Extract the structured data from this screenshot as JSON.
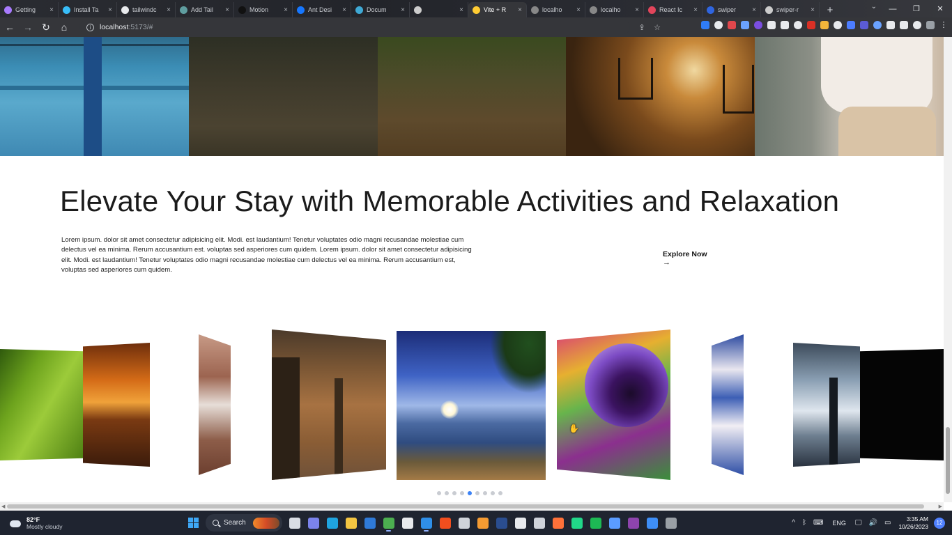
{
  "browser": {
    "tabs": [
      {
        "label": "Getting",
        "icon": "vite-icon",
        "color": "#a97bff"
      },
      {
        "label": "Install Ta",
        "icon": "tailwind-icon",
        "color": "#38bdf8"
      },
      {
        "label": "tailwindc",
        "icon": "google-icon",
        "color": "#e8eaed"
      },
      {
        "label": "Add Tail",
        "icon": "globe-icon",
        "color": "#5f9ea0"
      },
      {
        "label": "Motion",
        "icon": "framer-icon",
        "color": "#111111"
      },
      {
        "label": "Ant Desi",
        "icon": "antd-icon",
        "color": "#1677ff"
      },
      {
        "label": "Docum",
        "icon": "doc-icon",
        "color": "#3fa9d5"
      },
      {
        "label": "",
        "icon": "move-icon",
        "color": "#cccccc"
      },
      {
        "label": "Vite + R",
        "icon": "vite-icon",
        "color": "#ffcc33",
        "active": true
      },
      {
        "label": "localho",
        "icon": "globe-icon",
        "color": "#888888"
      },
      {
        "label": "localho",
        "icon": "globe-icon",
        "color": "#888888"
      },
      {
        "label": "React Ic",
        "icon": "react-icons-icon",
        "color": "#e2455b"
      },
      {
        "label": "swiper",
        "icon": "swiper-icon",
        "color": "#2f65e0"
      },
      {
        "label": "swiper-r",
        "icon": "code-icon",
        "color": "#cccccc"
      }
    ],
    "close_glyph": "×",
    "new_tab_glyph": "+",
    "tab_search_glyph": "⌄",
    "window_controls": {
      "minimize": "—",
      "restore": "❐",
      "close": "✕"
    },
    "nav": {
      "back": "←",
      "forward": "→",
      "reload": "↻",
      "home": "⌂"
    },
    "url_host": "localhost",
    "url_rest": ":5173/#",
    "addr_actions": {
      "share": "⇪",
      "bookmark": "☆"
    },
    "extensions": [
      {
        "name": "play-ext-icon",
        "color": "#2f7cf6"
      },
      {
        "name": "chat-ext-icon",
        "color": "#e8eaed"
      },
      {
        "name": "c-ext-icon",
        "color": "#e0474c"
      },
      {
        "name": "link-ext-icon",
        "color": "#6aa2ff"
      },
      {
        "name": "purple-ext-icon",
        "color": "#7a4ee0"
      },
      {
        "name": "box-ext-icon",
        "color": "#e8eaed"
      },
      {
        "name": "download-ext-icon",
        "color": "#e8eaed"
      },
      {
        "name": "target-ext-icon",
        "color": "#e8eaed"
      },
      {
        "name": "red-ext-icon",
        "color": "#d93025"
      },
      {
        "name": "yellow-ext-icon",
        "color": "#f2b53a"
      },
      {
        "name": "white-ext-icon",
        "color": "#e8eaed"
      },
      {
        "name": "blue-ext-icon",
        "color": "#4c7dff"
      },
      {
        "name": "gpt-ext-icon",
        "color": "#5b5bd6"
      },
      {
        "name": "file-ext-icon",
        "color": "#6aa2ff"
      },
      {
        "name": "pin-ext-icon",
        "color": "#e8eaed"
      },
      {
        "name": "puzzle-ext-icon",
        "color": "#e8eaed"
      },
      {
        "name": "sidepanel-ext-icon",
        "color": "#e8eaed"
      },
      {
        "name": "profile-ext-icon",
        "color": "#9aa0a6"
      }
    ],
    "menu_glyph": "⋮"
  },
  "page": {
    "heading": "Elevate Your Stay with Memorable Activities and Relaxation",
    "intro": "Lorem ipsum. dolor sit amet consectetur adipisicing elit. Modi. est laudantium! Tenetur voluptates odio magni recusandae molestiae cum delectus vel ea minima. Rerum accusantium est. voluptas sed asperiores cum quidem. Lorem ipsum. dolor sit amet consectetur adipisicing elit. Modi. est laudantium! Tenetur voluptates odio magni recusandae molestiae cum delectus vel ea minima. Rerum accusantium est, voluptas sed asperiores cum quidem.",
    "explore_label": "Explore Now",
    "explore_arrow": "→",
    "gallery": [
      "pool-photo",
      "mud-photo",
      "field-photo",
      "camping-photo",
      "woman-photo"
    ],
    "slides": [
      "grass-slide",
      "sunset-slide",
      "rock-slide",
      "autumn-tree-slide",
      "beach-slide",
      "pansy-slide",
      "orchid-slide",
      "cloud-tree-slide",
      "dark-slide"
    ],
    "pagination": {
      "count": 9,
      "active_index": 4
    },
    "accent_color": "#3b82f6"
  },
  "taskbar": {
    "weather_temp": "82°F",
    "weather_desc": "Mostly cloudy",
    "search_label": "Search",
    "apps": [
      {
        "name": "file-explorer-taskbar-icon",
        "color": "#d9dde4"
      },
      {
        "name": "teams-chat-icon",
        "color": "#7b83eb"
      },
      {
        "name": "edge-icon",
        "color": "#1fa4e0"
      },
      {
        "name": "folder-icon",
        "color": "#f4c542"
      },
      {
        "name": "mail-icon",
        "color": "#2f7ad8"
      },
      {
        "name": "chrome-icon",
        "color": "#4caf50",
        "running": true
      },
      {
        "name": "store-icon",
        "color": "#e8eaed"
      },
      {
        "name": "vscode-icon",
        "color": "#2f8fe8",
        "running": true
      },
      {
        "name": "figma-icon",
        "color": "#f24e1e"
      },
      {
        "name": "unity-icon",
        "color": "#cfd3da"
      },
      {
        "name": "sublime-icon",
        "color": "#f59b32"
      },
      {
        "name": "terminal-icon",
        "color": "#2a4d8f"
      },
      {
        "name": "hs-icon",
        "color": "#e8eaed"
      },
      {
        "name": "tool-icon",
        "color": "#cfd3da"
      },
      {
        "name": "firefox-icon",
        "color": "#ff7139"
      },
      {
        "name": "pycharm-icon",
        "color": "#21d789"
      },
      {
        "name": "spotify-icon",
        "color": "#1db954"
      },
      {
        "name": "box3d-icon",
        "color": "#5b9cff"
      },
      {
        "name": "vs-icon",
        "color": "#8e44ad"
      },
      {
        "name": "photos-icon",
        "color": "#3e8ef7"
      },
      {
        "name": "settings-icon",
        "color": "#9aa0a6"
      }
    ],
    "tray": {
      "chevron": "^",
      "lang": "ENG"
    },
    "clock_time": "3:35 AM",
    "clock_date": "10/26/2023",
    "notification_count": "12"
  }
}
